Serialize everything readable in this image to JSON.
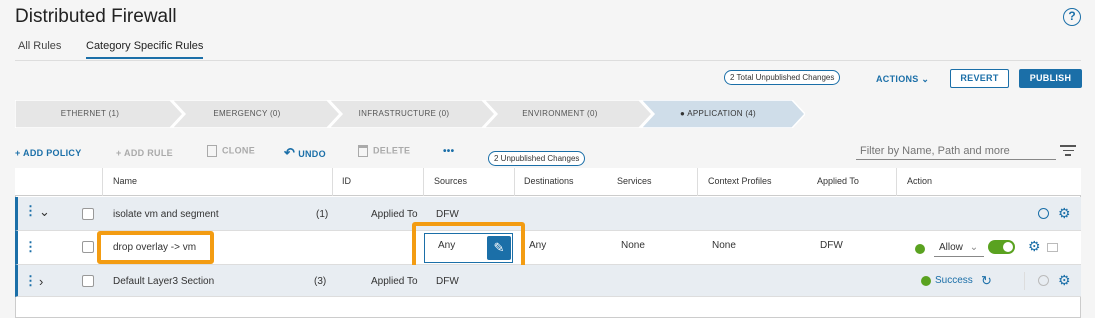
{
  "page": {
    "title": "Distributed Firewall",
    "help": "?"
  },
  "tabs": [
    "All Rules",
    "Category Specific Rules"
  ],
  "header_actions": {
    "unpublished_total": "2 Total Unpublished Changes",
    "actions": "ACTIONS",
    "revert": "REVERT",
    "publish": "PUBLISH"
  },
  "categories": [
    "ETHERNET (1)",
    "EMERGENCY (0)",
    "INFRASTRUCTURE (0)",
    "ENVIRONMENT (0)",
    "APPLICATION (4)"
  ],
  "active_category_marker": "●",
  "toolbar": {
    "add_policy": "+ ADD POLICY",
    "add_rule": "+ ADD RULE",
    "clone": "CLONE",
    "undo": "UNDO",
    "delete": "DELETE",
    "more": "•••",
    "unpublished": "2 Unpublished Changes",
    "filter_placeholder": "Filter by Name, Path and more"
  },
  "columns": [
    "Name",
    "ID",
    "Sources",
    "Destinations",
    "Services",
    "Context Profiles",
    "Applied To",
    "Action"
  ],
  "policy1": {
    "name": "isolate vm and segment",
    "count": "(1)",
    "applied_label": "Applied To",
    "applied": "DFW"
  },
  "rule1": {
    "name": "drop overlay -> vm",
    "sources": "Any",
    "destinations": "Any",
    "services": "None",
    "applied": "DFW",
    "action": "Allow"
  },
  "policy2": {
    "name": "Default Layer3 Section",
    "count": "(3)",
    "applied_label": "Applied To",
    "applied": "DFW",
    "status": "Success"
  },
  "colors": {
    "accent": "#1b6fa8",
    "highlight": "#f39c12",
    "success": "#5aa220"
  }
}
